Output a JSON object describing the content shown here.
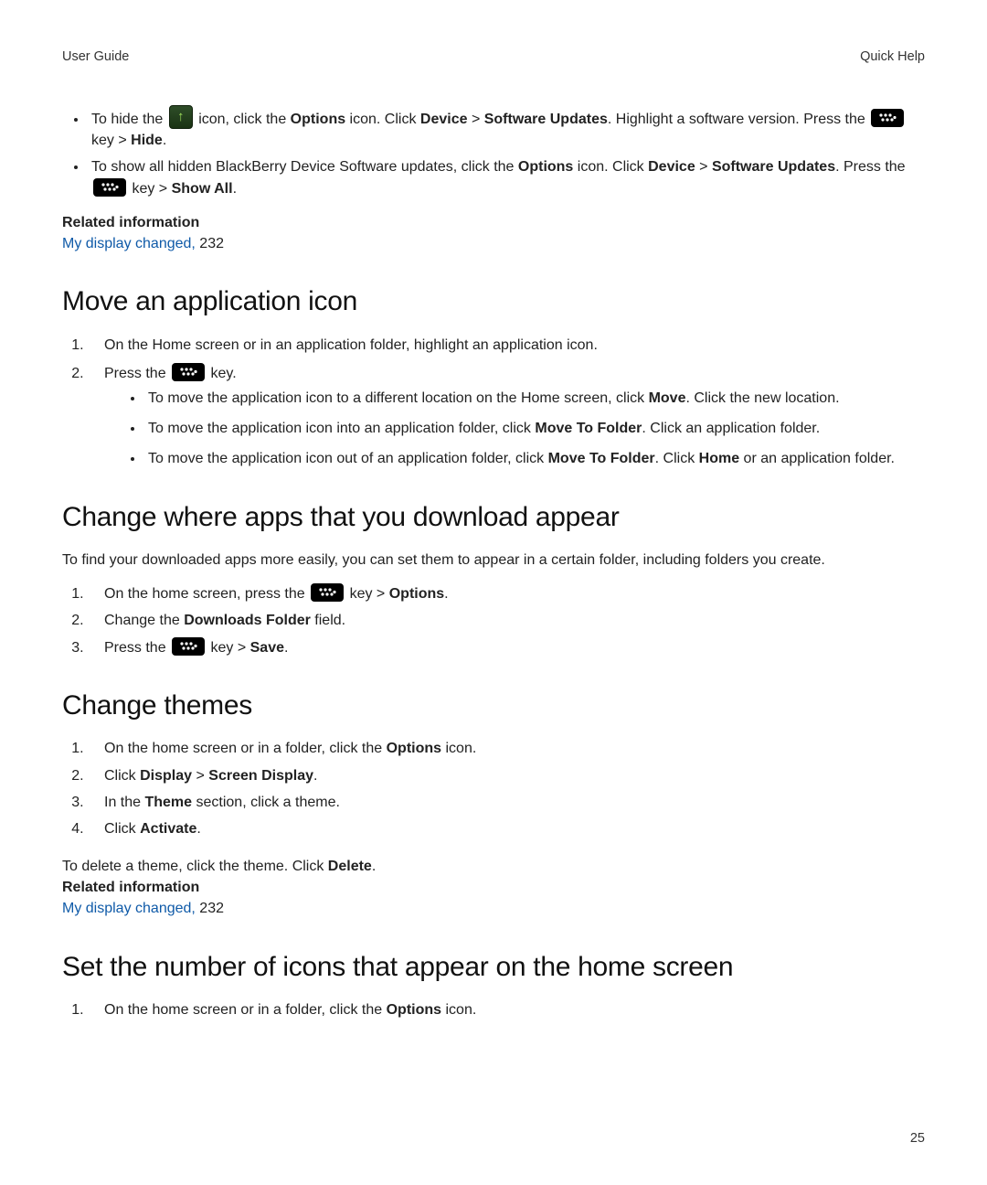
{
  "header": {
    "left": "User Guide",
    "right": "Quick Help"
  },
  "top_bullets": {
    "b1": {
      "pre": "To hide the ",
      "mid1": " icon, click the ",
      "options": "Options",
      "mid2": " icon. Click ",
      "device": "Device",
      "gt1": " > ",
      "sw": "Software Updates",
      "mid3": ". Highlight a software version. Press the ",
      "mid4": " key > ",
      "hide": "Hide",
      "end": "."
    },
    "b2": {
      "pre": "To show all hidden BlackBerry Device Software updates, click the ",
      "options": "Options",
      "mid1": " icon. Click ",
      "device": "Device",
      "gt1": " > ",
      "sw": "Software Updates",
      "mid2": ". Press the ",
      "mid3": " key > ",
      "showall": "Show All",
      "end": "."
    }
  },
  "related1": {
    "title": "Related information",
    "link": "My display changed,",
    "page": " 232"
  },
  "move": {
    "heading": "Move an application icon",
    "s1": "On the Home screen or in an application folder, highlight an application icon.",
    "s2a": "Press the ",
    "s2b": " key.",
    "sub1a": "To move the application icon to a different location on the Home screen, click ",
    "sub1b": "Move",
    "sub1c": ". Click the new location.",
    "sub2a": "To move the application icon into an application folder, click ",
    "sub2b": "Move To Folder",
    "sub2c": ". Click an application folder.",
    "sub3a": "To move the application icon out of an application folder, click ",
    "sub3b": "Move To Folder",
    "sub3c": ". Click ",
    "sub3d": "Home",
    "sub3e": " or an application folder."
  },
  "downloads": {
    "heading": "Change where apps that you download appear",
    "intro": "To find your downloaded apps more easily, you can set them to appear in a certain folder, including folders you create.",
    "s1a": "On the home screen, press the ",
    "s1b": " key > ",
    "s1c": "Options",
    "s1d": ".",
    "s2a": "Change the ",
    "s2b": "Downloads Folder",
    "s2c": " field.",
    "s3a": "Press the ",
    "s3b": " key > ",
    "s3c": "Save",
    "s3d": "."
  },
  "themes": {
    "heading": "Change themes",
    "s1a": "On the home screen or in a folder, click the ",
    "s1b": "Options",
    "s1c": " icon.",
    "s2a": "Click ",
    "s2b": "Display",
    "s2c": " > ",
    "s2d": "Screen Display",
    "s2e": ".",
    "s3a": "In the ",
    "s3b": "Theme",
    "s3c": " section, click a theme.",
    "s4a": "Click ",
    "s4b": "Activate",
    "s4c": ".",
    "note_a": "To delete a theme, click the theme. Click ",
    "note_b": "Delete",
    "note_c": "."
  },
  "related2": {
    "title": "Related information",
    "link": "My display changed,",
    "page": " 232"
  },
  "setnum": {
    "heading": "Set the number of icons that appear on the home screen",
    "s1a": "On the home screen or in a folder, click the ",
    "s1b": "Options",
    "s1c": " icon."
  },
  "page_number": "25"
}
